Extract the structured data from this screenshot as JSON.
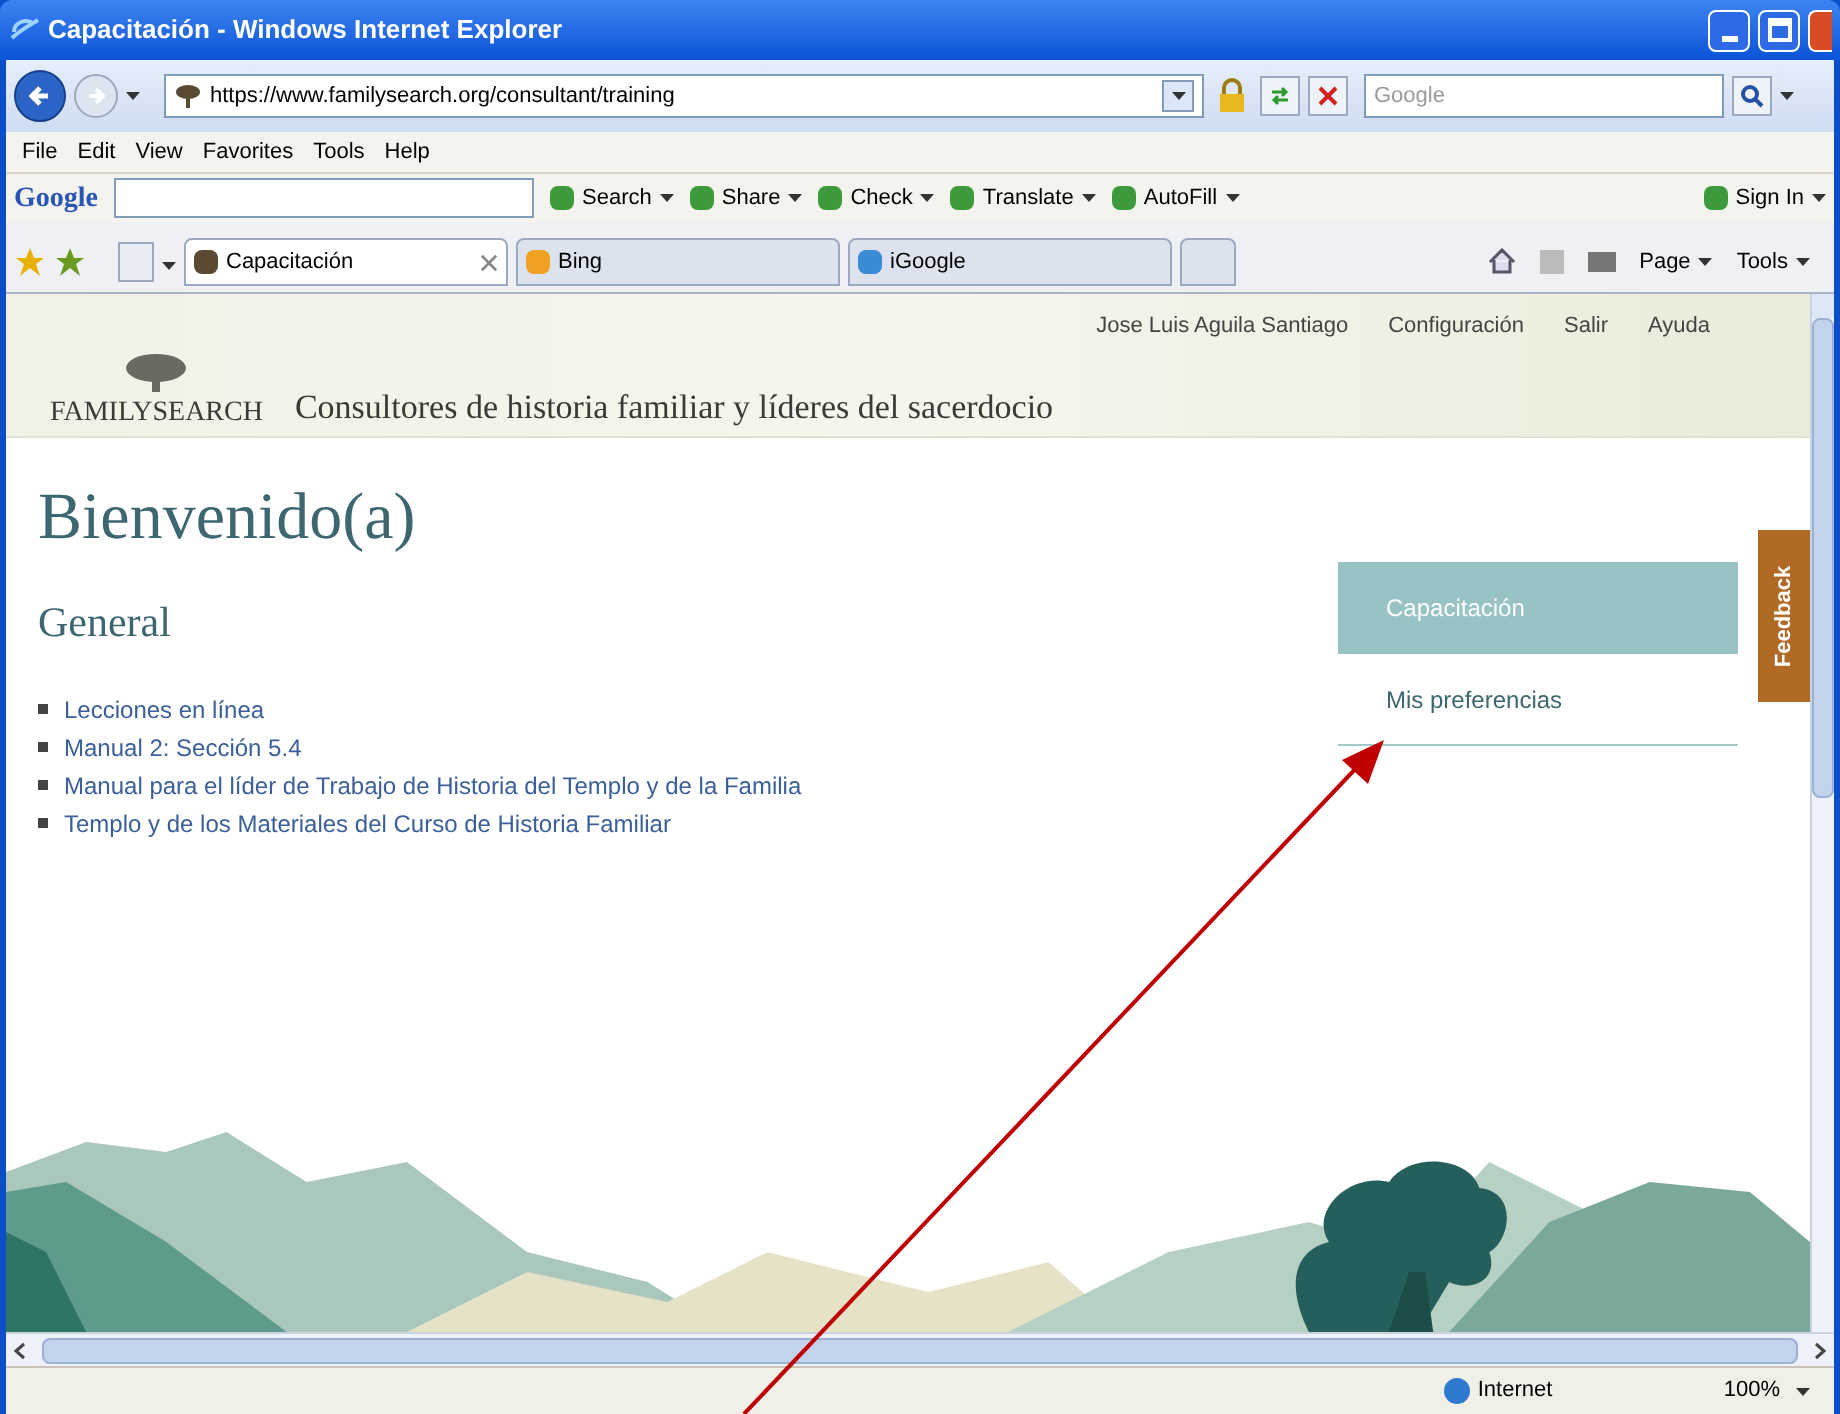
{
  "window": {
    "title": "Capacitación - Windows Internet Explorer"
  },
  "address_bar": {
    "url": "https://www.familysearch.org/consultant/training",
    "search_placeholder": "Google"
  },
  "menu": [
    "File",
    "Edit",
    "View",
    "Favorites",
    "Tools",
    "Help"
  ],
  "google_toolbar": {
    "logo": "Google",
    "buttons": [
      "Search",
      "Share",
      "Check",
      "Translate",
      "AutoFill",
      "Sign In"
    ]
  },
  "tabs": [
    {
      "label": "Capacitación",
      "selected": true
    },
    {
      "label": "Bing",
      "selected": false
    },
    {
      "label": "iGoogle",
      "selected": false
    }
  ],
  "command_bar": [
    "Page",
    "Tools"
  ],
  "page": {
    "logo": "FAMILYSEARCH",
    "site_title": "Consultores de historia familiar y líderes del sacerdocio",
    "user_links": [
      "Jose Luis Aguila Santiago",
      "Configuración",
      "Salir",
      "Ayuda"
    ],
    "heading": "Bienvenido(a)",
    "section": "General",
    "links": [
      "Lecciones en línea",
      "Manual 2: Sección 5.4",
      "Manual para el líder de Trabajo de Historia del Templo y de la Familia",
      "Templo y de los Materiales del Curso de Historia Familiar"
    ],
    "side_nav": [
      {
        "label": "Capacitación",
        "selected": true
      },
      {
        "label": "Mis preferencias",
        "selected": false
      }
    ],
    "feedback": "Feedback"
  },
  "status_bar": {
    "zone": "Internet",
    "zoom": "100%"
  }
}
